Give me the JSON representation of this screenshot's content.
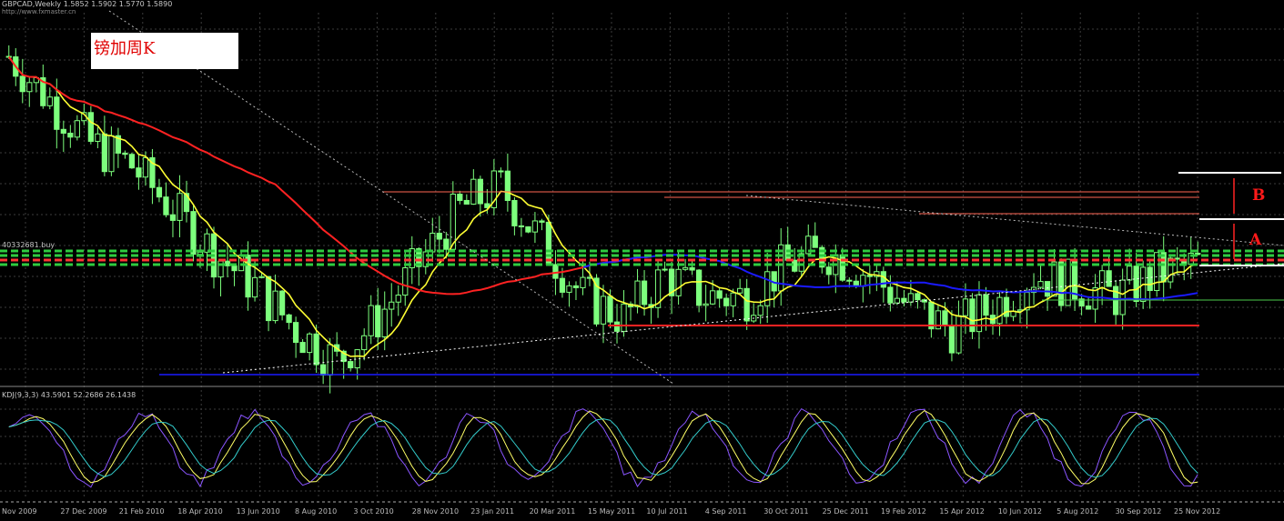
{
  "chart_window": {
    "header": "GBPCAD,Weekly  1.5852 1.5902 1.5770 1.5890",
    "watermark": "http://www.fxmaster.cn",
    "title_box": "镑加周K",
    "mid_label": "40332681.buy"
  },
  "annotations": {
    "A": "A",
    "B": "B"
  },
  "colors": {
    "background": "#000000",
    "grid": "#3c3c3c",
    "candle_up": "#000000",
    "candle_up_border": "#7dff7d",
    "candle_down": "#7dff7d",
    "ma_yellow": "#ffff33",
    "ma_red": "#ff2222",
    "ma_blue": "#1a1aff",
    "support_line": "#ff2222",
    "green_dash": "#2ecc40",
    "kdj_purple": "#8a55ff",
    "kdj_yellow": "#ffff66",
    "kdj_cyan": "#33cccc"
  },
  "chart_data": {
    "type": "candlestick",
    "symbol": "GBPCAD",
    "timeframe": "Weekly",
    "ohlc_last": {
      "open": 1.5852,
      "high": 1.5902,
      "low": 1.577,
      "close": 1.589
    },
    "x_tick_labels": [
      "Nov 2009",
      "27 Dec 2009",
      "21 Feb 2010",
      "18 Apr 2010",
      "13 Jun 2010",
      "8 Aug 2010",
      "3 Oct 2010",
      "28 Nov 2010",
      "23 Jan 2011",
      "20 Mar 2011",
      "15 May 2011",
      "10 Jul 2011",
      "4 Sep 2011",
      "30 Oct 2011",
      "25 Dec 2011",
      "19 Feb 2012",
      "15 Apr 2012",
      "10 Jun 2012",
      "5 Aug 2012",
      "30 Sep 2012",
      "25 Nov 2012"
    ],
    "price_series_approx": [
      1.8,
      1.76,
      1.72,
      1.7,
      1.66,
      1.62,
      1.59,
      1.55,
      1.52,
      1.56,
      1.61,
      1.66,
      1.68,
      1.63,
      1.58,
      1.56,
      1.6,
      1.58,
      1.58,
      1.61,
      1.62,
      1.6,
      1.57,
      1.55,
      1.57,
      1.6,
      1.59,
      1.58,
      1.6,
      1.61
    ],
    "indicator_panel": {
      "name": "KDJ(9,3,3)",
      "header": "KDJ(9,3,3) 43.5901 52.2686 26.1438",
      "values": [
        43.5901,
        52.2686,
        26.1438
      ]
    },
    "grid": true
  }
}
